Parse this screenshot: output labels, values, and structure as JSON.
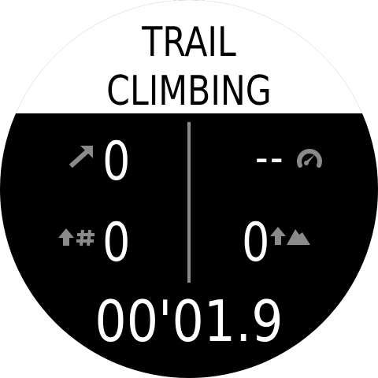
{
  "title": {
    "line1": "TRAIL",
    "line2": "CLIMBING"
  },
  "metrics": {
    "ascent_speed": {
      "icon": "diagonal-arrow-icon",
      "value": "0"
    },
    "vertical_speed": {
      "icon": "gauge-icon",
      "value": "--"
    },
    "laps": {
      "icon": "up-arrow-hash-icon",
      "value": "0"
    },
    "highest_point": {
      "icon": "up-arrow-mountain-icon",
      "value": "0"
    }
  },
  "timer": "00'01.9",
  "colors": {
    "background": "#000000",
    "header": "#ffffff",
    "text": "#ffffff",
    "icon": "#8a8a8a",
    "divider": "#8a8a8a"
  }
}
